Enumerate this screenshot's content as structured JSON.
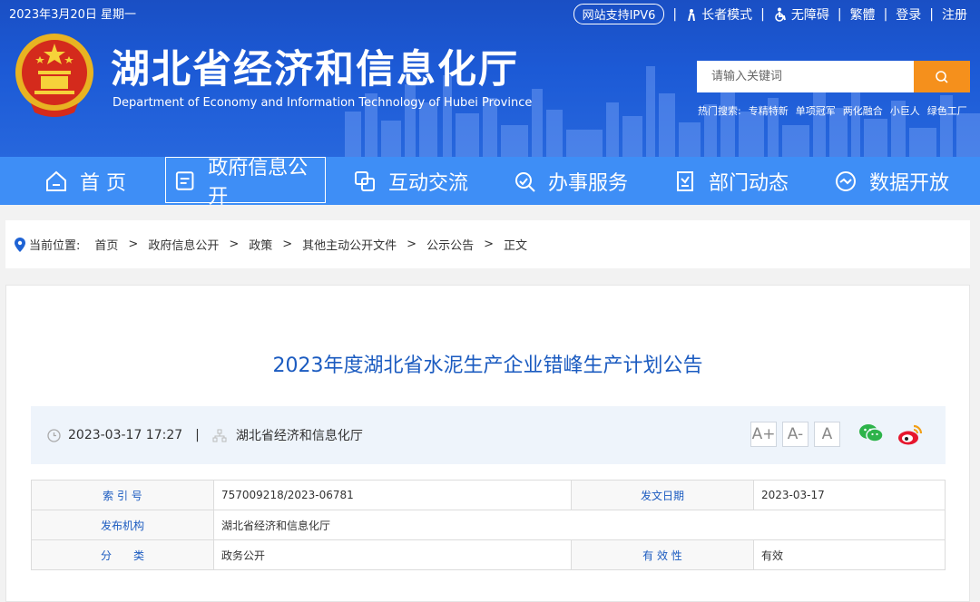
{
  "header": {
    "date": "2023年3月20日 星期一",
    "ipv6": "网站支持IPV6",
    "elder_mode": "长者模式",
    "accessibility": "无障碍",
    "traditional": "繁體",
    "login": "登录",
    "register": "注册",
    "site_title": "湖北省经济和信息化厅",
    "site_subtitle": "Department of Economy and Information Technology of Hubei Province",
    "search_placeholder": "请输入关键词",
    "hot_label": "热门搜索:",
    "hot_terms": [
      "专精特新",
      "单项冠军",
      "两化融合",
      "小巨人",
      "绿色工厂"
    ]
  },
  "nav": {
    "items": [
      {
        "label": "首  页",
        "icon": "home-icon"
      },
      {
        "label": "政府信息公开",
        "icon": "document-icon"
      },
      {
        "label": "互动交流",
        "icon": "interaction-icon"
      },
      {
        "label": "办事服务",
        "icon": "service-icon"
      },
      {
        "label": "部门动态",
        "icon": "news-icon"
      },
      {
        "label": "数据开放",
        "icon": "data-icon"
      }
    ],
    "active": 1
  },
  "breadcrumb": {
    "label": "当前位置:",
    "items": [
      "首页",
      "政府信息公开",
      "政策",
      "其他主动公开文件",
      "公示公告",
      "正文"
    ]
  },
  "article": {
    "title": "2023年度湖北省水泥生产企业错峰生产计划公告",
    "datetime": "2023-03-17 17:27",
    "source": "湖北省经济和信息化厅",
    "font_buttons": [
      "A+",
      "A-",
      "A"
    ],
    "share": [
      "wechat-icon",
      "weibo-icon"
    ]
  },
  "info_table": {
    "index_label": "索 引 号",
    "index_value": "757009218/2023-06781",
    "date_label": "发文日期",
    "date_value": "2023-03-17",
    "org_label": "发布机构",
    "org_value": "湖北省经济和信息化厅",
    "category_label": "分　　类",
    "category_value": "政务公开",
    "validity_label": "有 效 性",
    "validity_value": "有效"
  },
  "colors": {
    "header_blue": "#1c5ad6",
    "nav_blue": "#3e8ef6",
    "search_orange": "#f5901c",
    "title_blue": "#1b5bc0"
  }
}
